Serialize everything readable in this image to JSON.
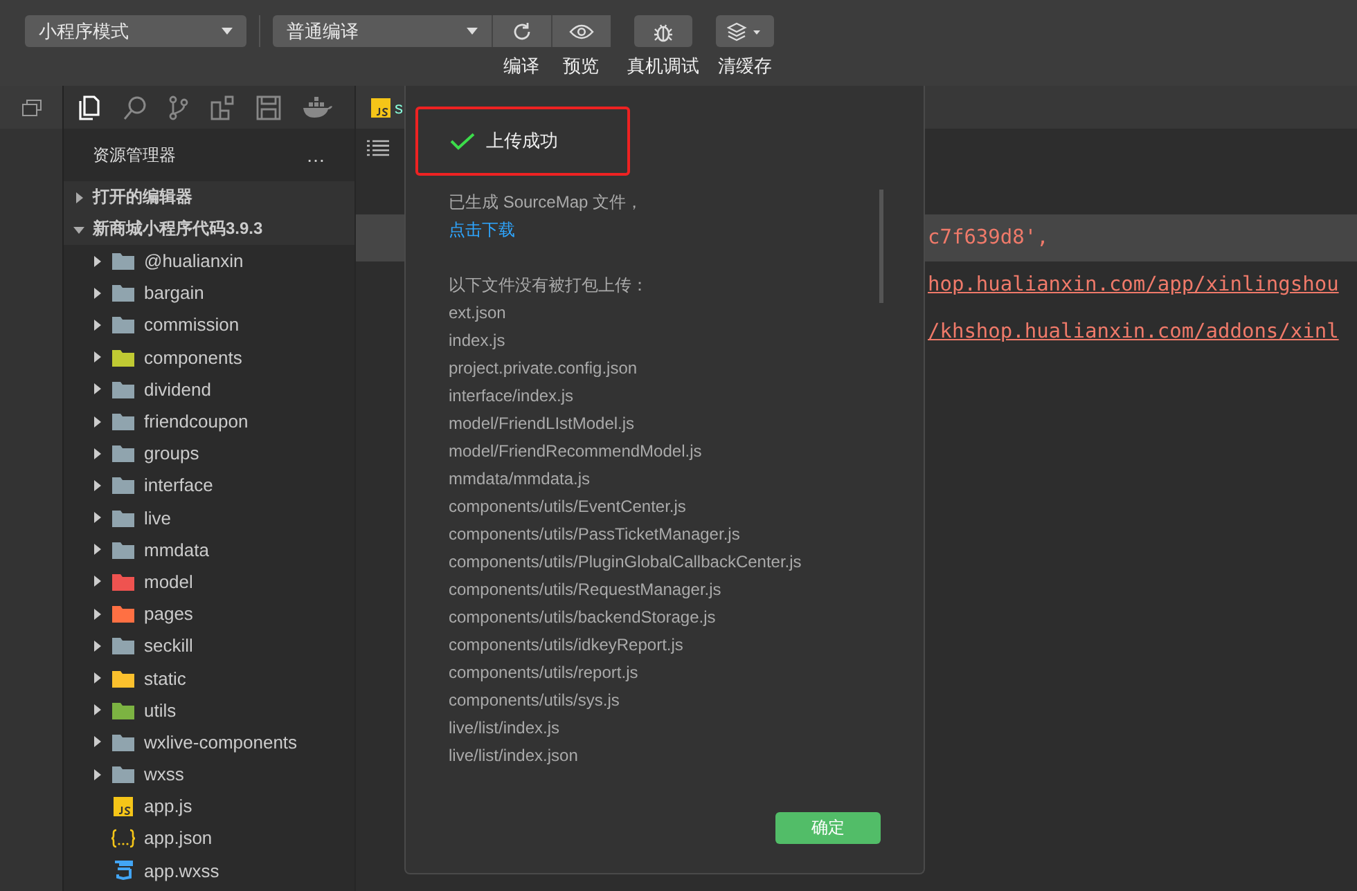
{
  "toolbar": {
    "mode_select": {
      "value": "小程序模式"
    },
    "compile_select": {
      "value": "普通编译"
    },
    "actions": [
      {
        "kind": "refresh",
        "label": "编译"
      },
      {
        "kind": "eye",
        "label": "预览"
      },
      {
        "kind": "bug",
        "label": "真机调试"
      },
      {
        "kind": "layers",
        "label": "清缓存"
      }
    ]
  },
  "sidebar": {
    "title": "资源管理器",
    "more": "…",
    "sections": [
      {
        "label": "打开的编辑器",
        "expanded": false
      },
      {
        "label": "新商城小程序代码3.9.3",
        "expanded": true,
        "children": [
          {
            "name": "@hualianxin",
            "kind": "folder",
            "color": "#90a4ae",
            "expanded": false
          },
          {
            "name": "bargain",
            "kind": "folder",
            "color": "#90a4ae",
            "expanded": false
          },
          {
            "name": "commission",
            "kind": "folder",
            "color": "#90a4ae",
            "expanded": false
          },
          {
            "name": "components",
            "kind": "folder",
            "color": "#c0ca33",
            "expanded": false
          },
          {
            "name": "dividend",
            "kind": "folder",
            "color": "#90a4ae",
            "expanded": false
          },
          {
            "name": "friendcoupon",
            "kind": "folder",
            "color": "#90a4ae",
            "expanded": false
          },
          {
            "name": "groups",
            "kind": "folder",
            "color": "#90a4ae",
            "expanded": false
          },
          {
            "name": "interface",
            "kind": "folder",
            "color": "#90a4ae",
            "expanded": false
          },
          {
            "name": "live",
            "kind": "folder",
            "color": "#90a4ae",
            "expanded": false
          },
          {
            "name": "mmdata",
            "kind": "folder",
            "color": "#90a4ae",
            "expanded": false
          },
          {
            "name": "model",
            "kind": "folder",
            "color": "#ef5350",
            "expanded": false
          },
          {
            "name": "pages",
            "kind": "folder",
            "color": "#ff7043",
            "expanded": false
          },
          {
            "name": "seckill",
            "kind": "folder",
            "color": "#90a4ae",
            "expanded": false
          },
          {
            "name": "static",
            "kind": "folder",
            "color": "#fbc02d",
            "expanded": false
          },
          {
            "name": "utils",
            "kind": "folder",
            "color": "#7cb342",
            "expanded": false
          },
          {
            "name": "wxlive-components",
            "kind": "folder",
            "color": "#90a4ae",
            "expanded": false
          },
          {
            "name": "wxss",
            "kind": "folder",
            "color": "#90a4ae",
            "expanded": false
          },
          {
            "name": "app.js",
            "kind": "js"
          },
          {
            "name": "app.json",
            "kind": "json"
          },
          {
            "name": "app.wxss",
            "kind": "css"
          }
        ]
      }
    ]
  },
  "editor": {
    "tab": {
      "label": "s",
      "kind": "js"
    },
    "lines": [
      {
        "text": "c7f639d8',",
        "highlighted": true,
        "underlined": false
      },
      {
        "text": "hop.hualianxin.com/app/xinlingshou",
        "highlighted": false,
        "underlined": true
      },
      {
        "text": "/khshop.hualianxin.com/addons/xinl",
        "highlighted": false,
        "underlined": true
      }
    ]
  },
  "dialog": {
    "title": "上传成功",
    "sourcemap_note": "已生成 SourceMap 文件，",
    "download_link": "点击下载",
    "list_heading": "以下文件没有被打包上传：",
    "files": [
      "ext.json",
      "index.js",
      "project.private.config.json",
      "interface/index.js",
      "model/FriendLIstModel.js",
      "model/FriendRecommendModel.js",
      "mmdata/mmdata.js",
      "components/utils/EventCenter.js",
      "components/utils/PassTicketManager.js",
      "components/utils/PluginGlobalCallbackCenter.js",
      "components/utils/RequestManager.js",
      "components/utils/backendStorage.js",
      "components/utils/idkeyReport.js",
      "components/utils/report.js",
      "components/utils/sys.js",
      "live/list/index.js",
      "live/list/index.json"
    ],
    "confirm_button": "确定"
  }
}
